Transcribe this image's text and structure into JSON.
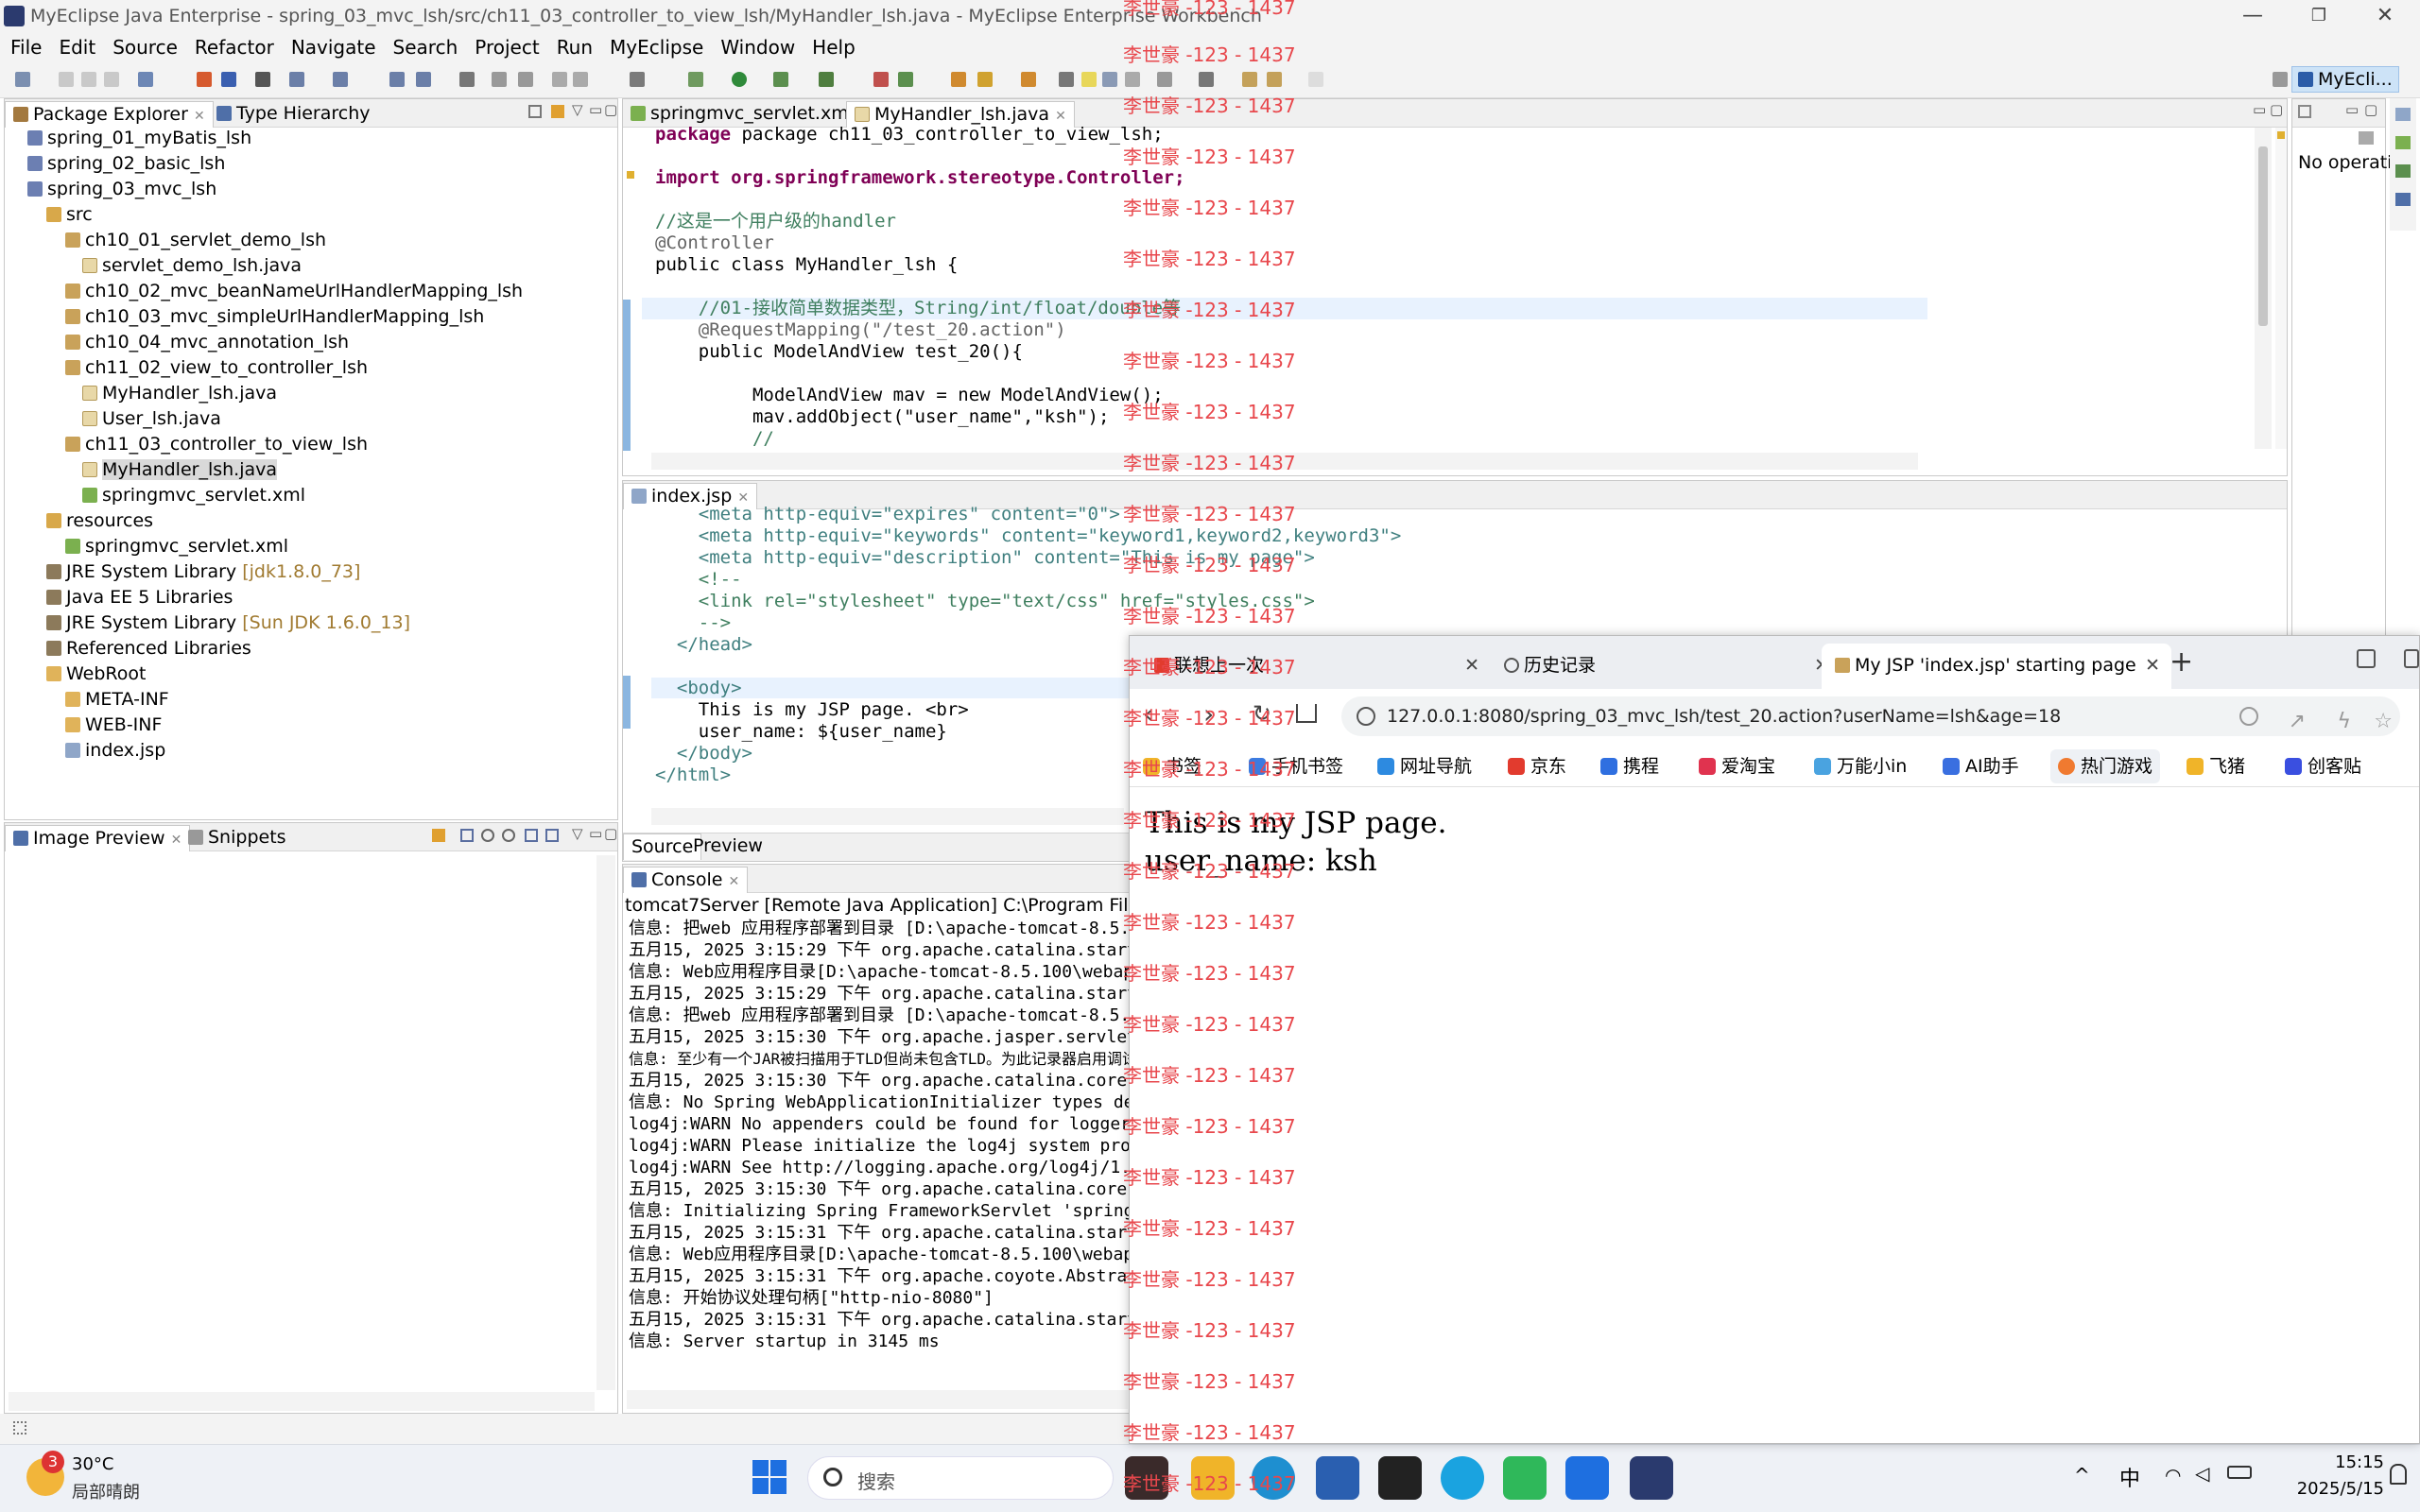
{
  "window": {
    "title": "MyEclipse Java Enterprise - spring_03_mvc_lsh/src/ch11_03_controller_to_view_lsh/MyHandler_lsh.java - MyEclipse Enterprise Workbench",
    "minimize": "—",
    "maximize": "❐",
    "close": "✕"
  },
  "menu": [
    "File",
    "Edit",
    "Source",
    "Refactor",
    "Navigate",
    "Search",
    "Project",
    "Run",
    "MyEclipse",
    "Window",
    "Help"
  ],
  "perspective": "MyEcli...",
  "explorer": {
    "tab_active": "Package Explorer",
    "tab_other": "Type Hierarchy",
    "items": [
      {
        "label": "spring_01_myBatis_lsh",
        "extra": ""
      },
      {
        "label": "spring_02_basic_lsh",
        "extra": ""
      },
      {
        "label": "spring_03_mvc_lsh",
        "extra": ""
      },
      {
        "label": "src",
        "extra": ""
      },
      {
        "label": "ch10_01_servlet_demo_lsh",
        "extra": ""
      },
      {
        "label": "servlet_demo_lsh.java",
        "extra": ""
      },
      {
        "label": "ch10_02_mvc_beanNameUrlHandlerMapping_lsh",
        "extra": ""
      },
      {
        "label": "ch10_03_mvc_simpleUrlHandlerMapping_lsh",
        "extra": ""
      },
      {
        "label": "ch10_04_mvc_annotation_lsh",
        "extra": ""
      },
      {
        "label": "ch11_02_view_to_controller_lsh",
        "extra": ""
      },
      {
        "label": "MyHandler_lsh.java",
        "extra": ""
      },
      {
        "label": "User_lsh.java",
        "extra": ""
      },
      {
        "label": "ch11_03_controller_to_view_lsh",
        "extra": ""
      },
      {
        "label": "MyHandler_lsh.java",
        "extra": ""
      },
      {
        "label": "springmvc_servlet.xml",
        "extra": ""
      },
      {
        "label": "resources",
        "extra": ""
      },
      {
        "label": "springmvc_servlet.xml",
        "extra": ""
      },
      {
        "label": "JRE System Library",
        "extra": "[jdk1.8.0_73]"
      },
      {
        "label": "Java EE 5 Libraries",
        "extra": ""
      },
      {
        "label": "JRE System Library",
        "extra": "[Sun JDK 1.6.0_13]"
      },
      {
        "label": "Referenced Libraries",
        "extra": ""
      },
      {
        "label": "WebRoot",
        "extra": ""
      },
      {
        "label": "META-INF",
        "extra": ""
      },
      {
        "label": "WEB-INF",
        "extra": ""
      },
      {
        "label": "index.jsp",
        "extra": ""
      }
    ]
  },
  "image_preview": {
    "tab_active": "Image Preview",
    "tab_other": "Snippets"
  },
  "editor": {
    "tab1": "springmvc_servlet.xml",
    "tab2": "MyHandler_lsh.java",
    "lines": [
      "package ch11_03_controller_to_view_lsh;",
      "",
      "import org.springframework.stereotype.Controller;",
      "",
      "//这是一个用户级的handler",
      "@Controller",
      "public class MyHandler_lsh {",
      "",
      "    //01-接收简单数据类型，String/int/float/double等",
      "    @RequestMapping(\"/test_20.action\")",
      "    public ModelAndView test_20(){",
      "",
      "         ModelAndView mav = new ModelAndView();",
      "         mav.addObject(\"user_name\",\"ksh\");",
      "         //"
    ]
  },
  "jsp_editor": {
    "tab": "index.jsp",
    "lines": [
      "    <meta http-equiv=\"expires\" content=\"0\">",
      "    <meta http-equiv=\"keywords\" content=\"keyword1,keyword2,keyword3\">",
      "    <meta http-equiv=\"description\" content=\"This is my page\">",
      "    <!--",
      "    <link rel=\"stylesheet\" type=\"text/css\" href=\"styles.css\">",
      "    -->",
      "  </head>",
      "",
      "  <body>",
      "    This is my JSP page. <br>",
      "    user_name: ${user_name}",
      "  </body>",
      "</html>"
    ],
    "source_tab": "Source",
    "preview_tab": "Preview"
  },
  "outline": {
    "text": "No operati"
  },
  "console": {
    "tab": "Console",
    "header": "tomcat7Server [Remote Java Application] C:\\Program Files (x86",
    "lines": [
      "信息: 把web 应用程序部署到目录 [D:\\apache-tomcat-8.5.100\\",
      "五月15, 2025 3:15:29 下午 org.apache.catalina.startu",
      "信息: Web应用程序目录[D:\\apache-tomcat-8.5.100\\webapps",
      "五月15, 2025 3:15:29 下午 org.apache.catalina.startu",
      "信息: 把web 应用程序部署到目录 [D:\\apache-tomcat-8.5.100\\",
      "五月15, 2025 3:15:30 下午 org.apache.jasper.servlet.",
      "信息: 至少有一个JAR被扫描用于TLD但尚未包含TLD。为此记录器启用调试",
      "五月15, 2025 3:15:30 下午 org.apache.catalina.core.A",
      "信息: No Spring WebApplicationInitializer types det",
      "log4j:WARN No appenders could be found for logger",
      "log4j:WARN Please initialize the log4j system prop",
      "log4j:WARN See http://logging.apache.org/log4j/1.",
      "五月15, 2025 3:15:30 下午 org.apache.catalina.core.A",
      "信息: Initializing Spring FrameworkServlet 'springm",
      "五月15, 2025 3:15:31 下午 org.apache.catalina.startu",
      "信息: Web应用程序目录[D:\\apache-tomcat-8.5.100\\webapps",
      "五月15, 2025 3:15:31 下午 org.apache.coyote.Abstract",
      "信息: 开始协议处理句柄[\"http-nio-8080\"]",
      "五月15, 2025 3:15:31 下午 org.apache.catalina.startu",
      "信息: Server startup in 3145 ms"
    ]
  },
  "browser": {
    "tabs": [
      "联想上一次",
      "历史记录",
      "My JSP 'index.jsp' starting page"
    ],
    "new_tab": "+",
    "url": "127.0.0.1:8080/spring_03_mvc_lsh/test_20.action?userName=lsh&age=18",
    "bookmarks": [
      "书签",
      "手机书签",
      "网址导航",
      "京东",
      "携程",
      "爱淘宝",
      "万能小in",
      "AI助手",
      "热门游戏",
      "飞猪",
      "创客贴"
    ],
    "page_line1": "This is my JSP page.",
    "page_line2": "user_name: ksh"
  },
  "watermark": "李世豪 -123 - 1437",
  "taskbar": {
    "weather_temp": "30°C",
    "weather_desc": "局部晴朗",
    "weather_badge": "3",
    "search": "搜索",
    "ime": "中",
    "time": "15:15",
    "date": "2025/5/15"
  }
}
